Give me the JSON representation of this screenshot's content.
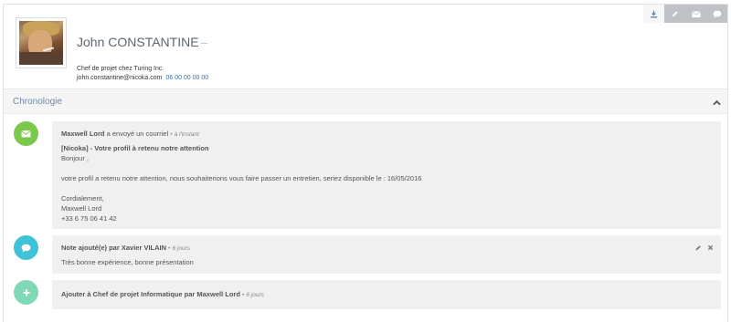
{
  "toolbar": {
    "buttons": [
      "download-icon",
      "pencil-icon",
      "envelope-icon",
      "comment-icon"
    ]
  },
  "profile": {
    "name": "John CONSTANTINE",
    "name_suffix": "–",
    "job": "Chef de projet chez Turing Inc.",
    "email": "john.constantine@nicoka.com",
    "phone": "06 00 00 00 00"
  },
  "section": {
    "title": "Chronologie"
  },
  "colors": {
    "email_icon": "#7bc84d",
    "note_icon": "#3fc1d6",
    "add_icon": "#7fd9b4",
    "link": "#3a71a8"
  },
  "timeline": [
    {
      "icon": "envelope-icon",
      "actor": "Maxwell Lord",
      "action": "a envoyé un courriel",
      "sep": "•",
      "time": "à l'instant",
      "subject": "[Nicoka] - Votre profil à retenu notre attention",
      "lines": [
        "Bonjour ,",
        "",
        "votre profil a retenu notre attention, nous souhaiterions vous faire passer un entretien, seriez disponible le : 16/05/2016",
        "",
        "Cordialement,",
        "Maxwell Lord",
        "+33 6 75 06 41 42"
      ]
    },
    {
      "icon": "comment-icon",
      "prefix": "Note ajouté(e) par",
      "actor": "Xavier VILAIN",
      "sep": "•",
      "time": "6 jours",
      "text": "Très bonne expérience, bonne présentation"
    },
    {
      "icon": "plus-icon",
      "prefix": "Ajouter à",
      "target": "Chef de projet Informatique",
      "mid": "par",
      "actor": "Maxwell Lord",
      "sep": "•",
      "time": "6 jours"
    }
  ]
}
